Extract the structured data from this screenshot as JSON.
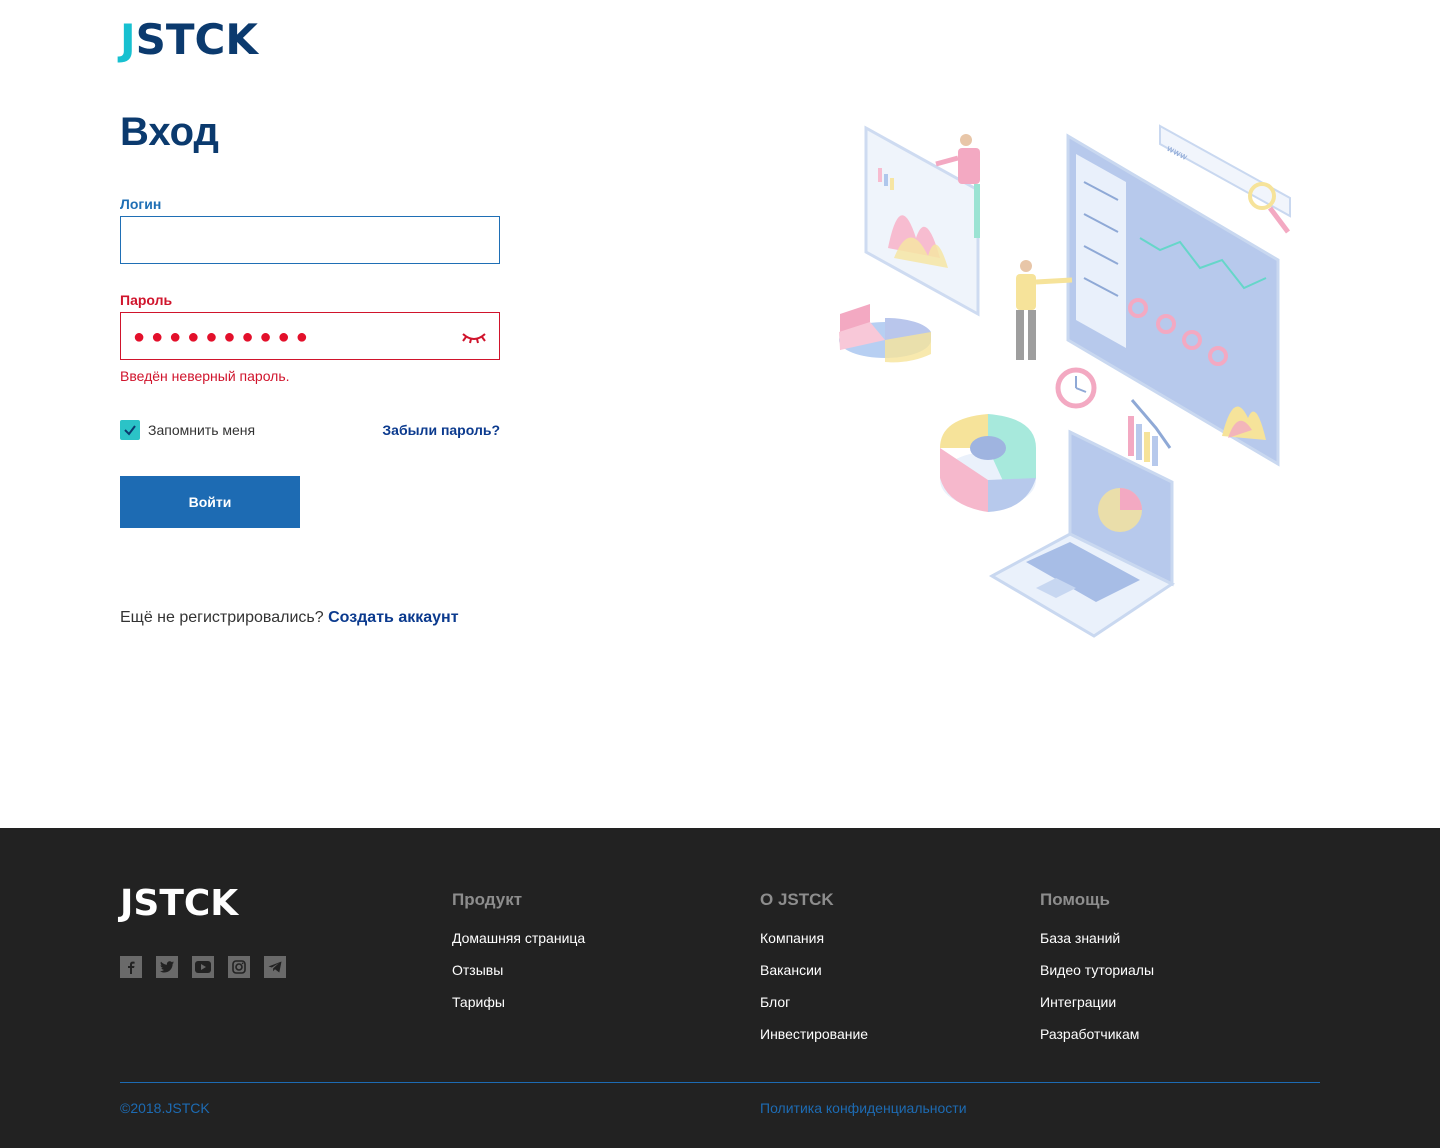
{
  "brand": {
    "logo_j": "J",
    "logo_rest": "STCK"
  },
  "login_form": {
    "title": "Вход",
    "login_label": "Логин",
    "login_value": "",
    "password_label": "Пароль",
    "password_mask": "●●●●●●●●●●",
    "error_text": "Введён неверный пароль.",
    "remember_label": "Запомнить меня",
    "remember_checked": true,
    "forgot_link": "Забыли пароль?",
    "submit_label": "Войти",
    "signup_prompt": "Ещё не регистрировались?",
    "signup_link": "Создать аккаунт"
  },
  "illustration": {
    "url_text": "www"
  },
  "footer": {
    "logo": "JSTCK",
    "social_icons": [
      "facebook-icon",
      "twitter-icon",
      "youtube-icon",
      "instagram-icon",
      "telegram-icon"
    ],
    "columns": [
      {
        "title": "Продукт",
        "links": [
          "Домашняя страница",
          "Отзывы",
          "Тарифы"
        ]
      },
      {
        "title": "О JSTCK",
        "links": [
          "Компания",
          "Вакансии",
          "Блог",
          "Инвестирование"
        ]
      },
      {
        "title": "Помощь",
        "links": [
          "База знаний",
          "Видео туториалы",
          "Интеграции",
          "Разработчикам"
        ]
      }
    ],
    "copyright": "©2018.JSTCK",
    "privacy": "Политика конфиденциальности"
  },
  "colors": {
    "brand_dark": "#0b3a6e",
    "brand_accent": "#17c0d0",
    "primary": "#1d6bb3",
    "error": "#d0142c",
    "footer_bg": "#222222"
  }
}
